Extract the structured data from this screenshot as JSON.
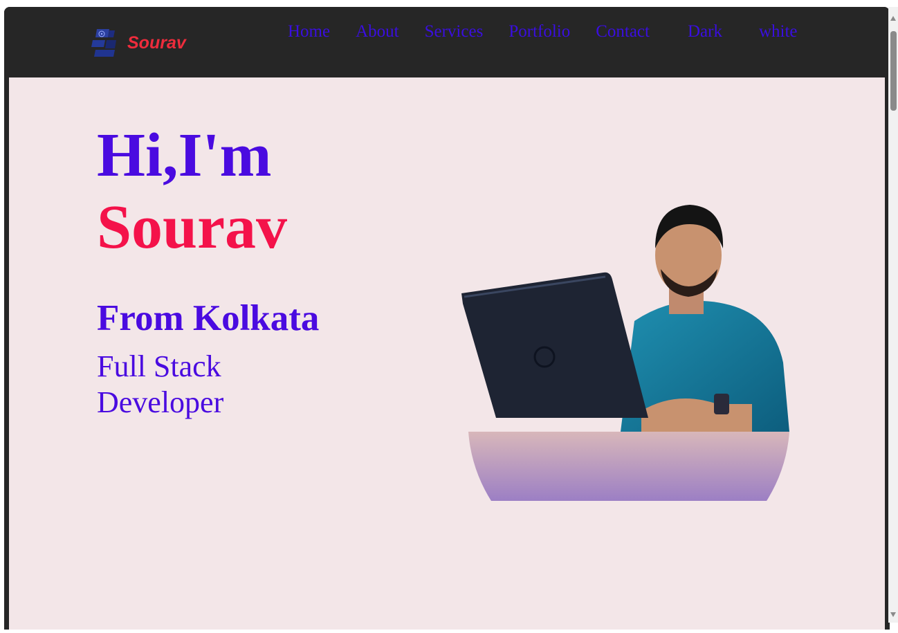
{
  "navbar": {
    "brand": "Sourav",
    "links": [
      {
        "label": "Home"
      },
      {
        "label": "About"
      },
      {
        "label": "Services"
      },
      {
        "label": "Portfolio"
      },
      {
        "label": "Contact"
      }
    ],
    "theme_dark_label": "Dark",
    "theme_light_label": "white",
    "brand_color": "#ee2c3c",
    "link_color": "#3a0ee0",
    "background": "#262626"
  },
  "hero": {
    "greeting": "Hi,I'm",
    "name": "Sourav",
    "location": "From Kolkata",
    "role": "Full Stack Developer",
    "photo_icon": "profile-photo",
    "primary_color": "#4a0be0",
    "accent_color": "#f4124a",
    "background": "#f3e6e8"
  }
}
